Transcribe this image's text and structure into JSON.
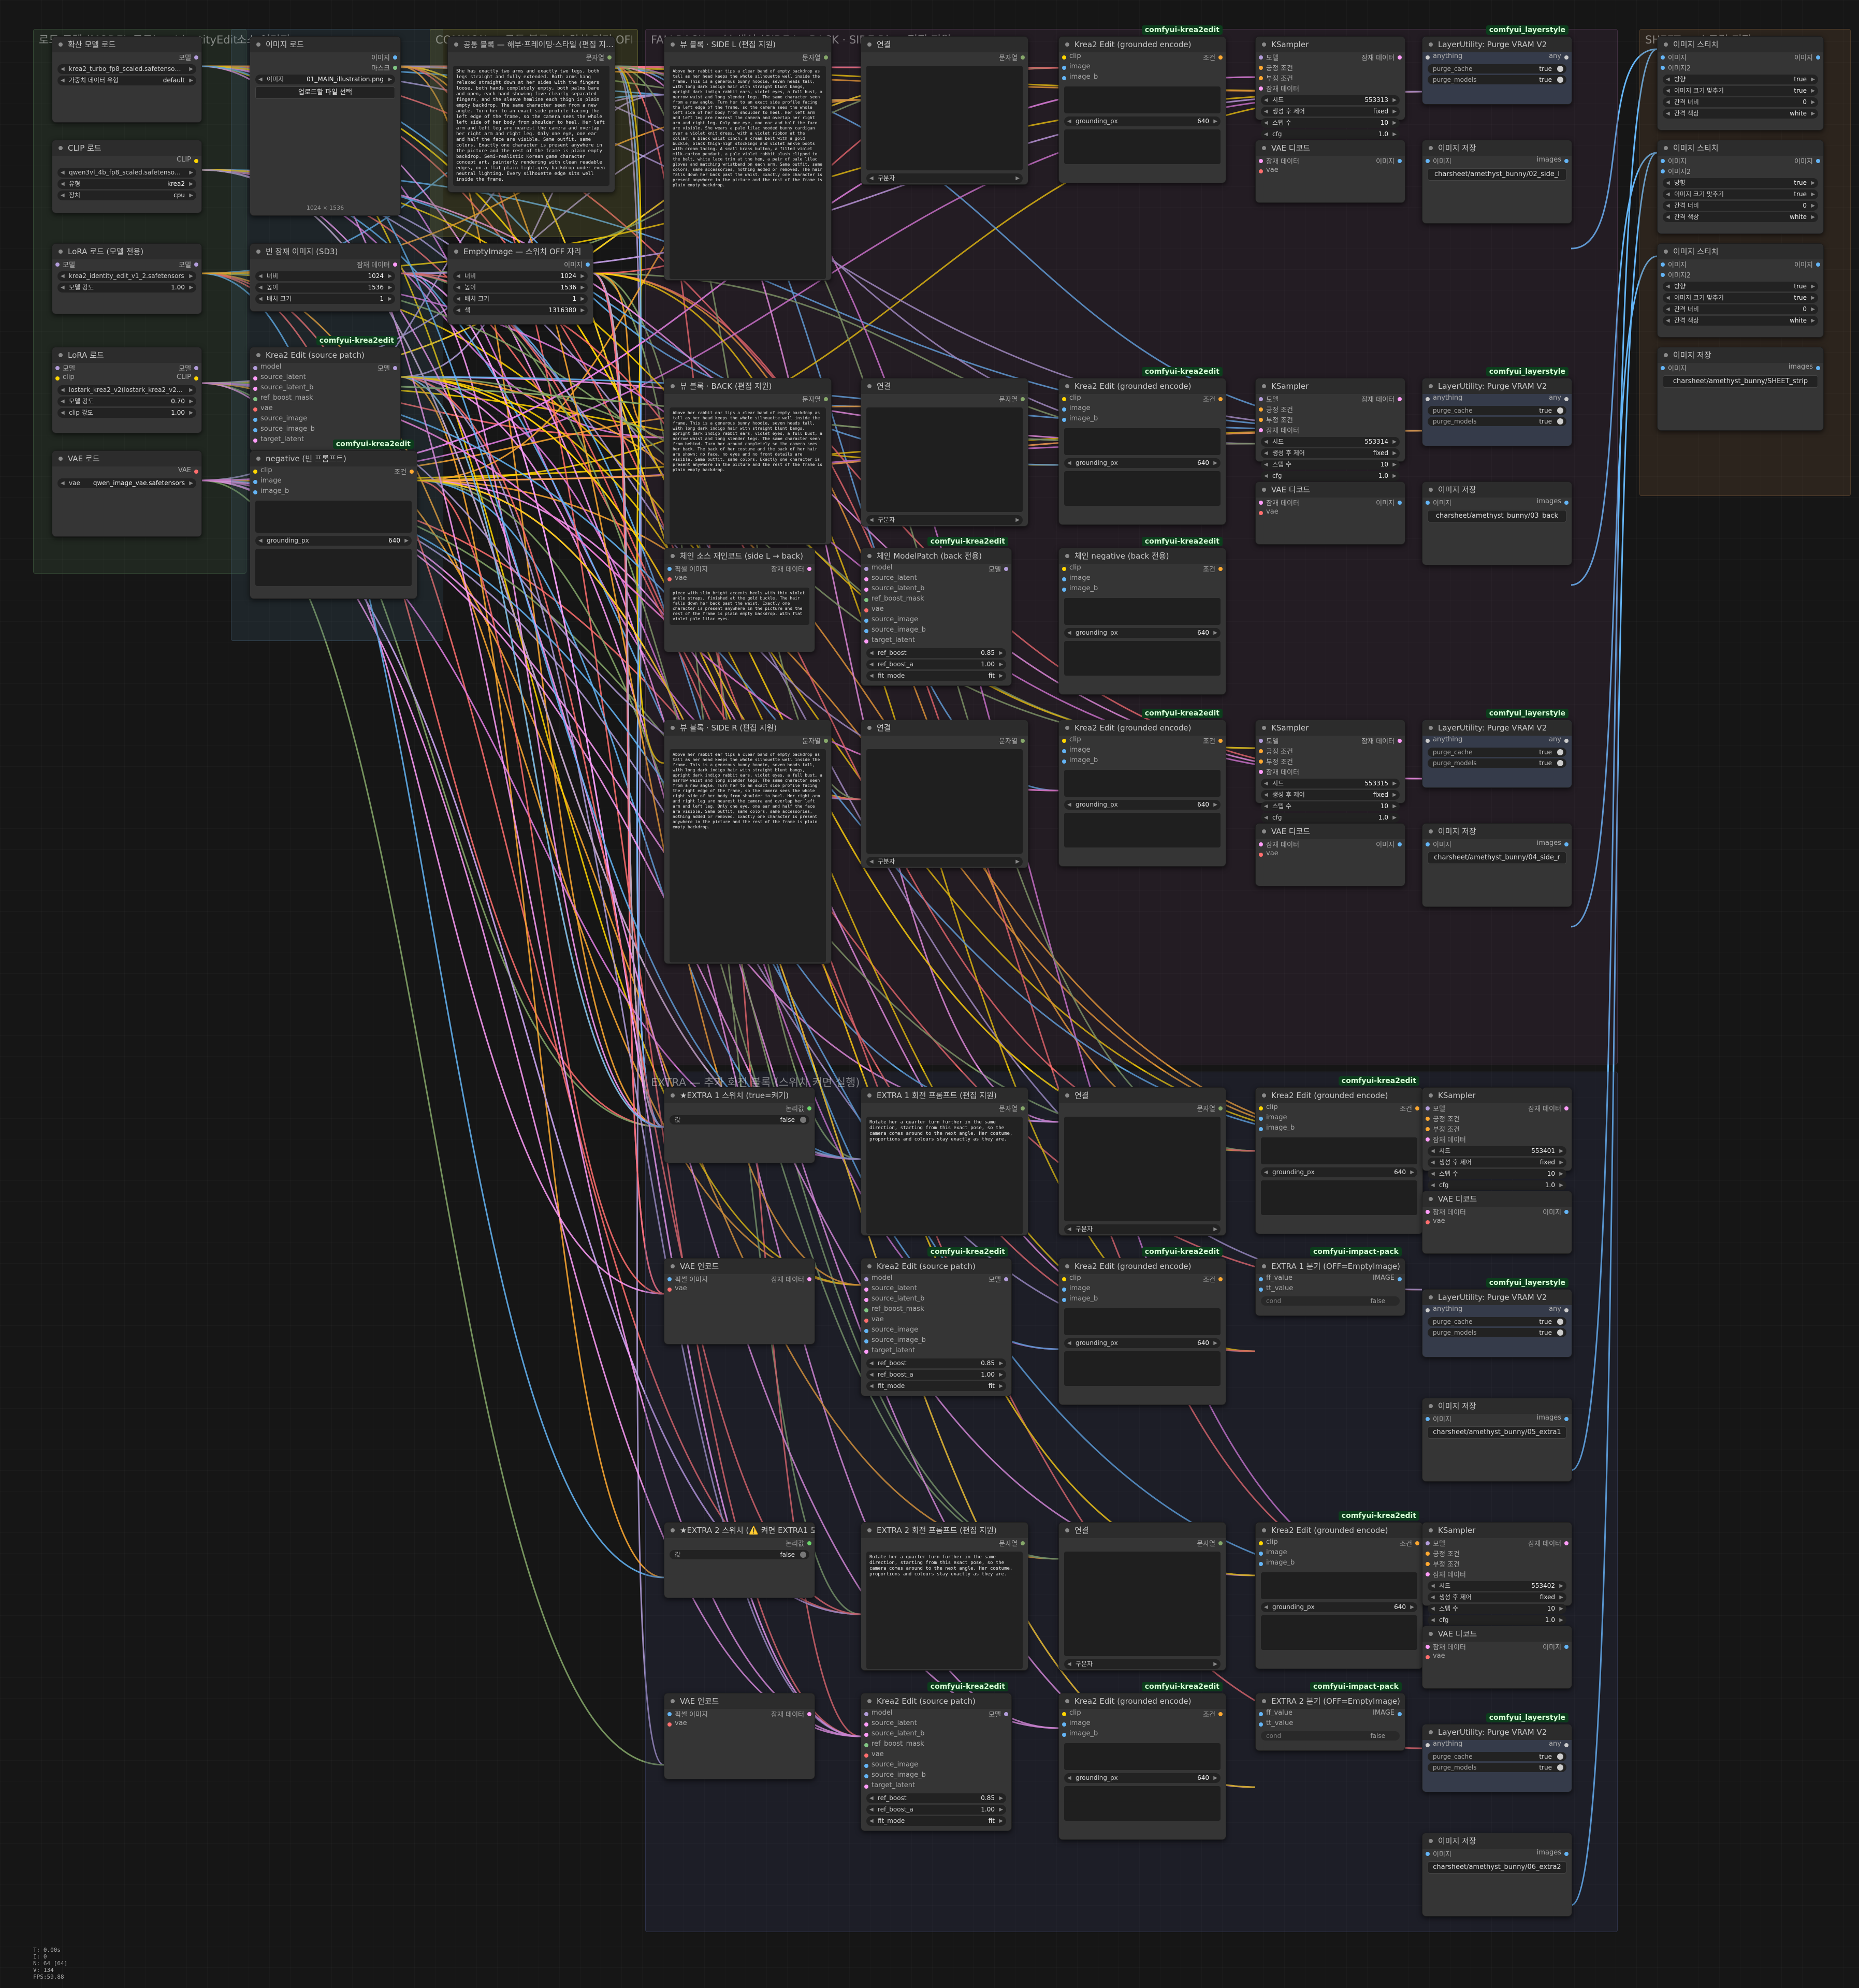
{
  "groups": {
    "load": "로드 모델 (MODEL 로드) — IdentityEdit + 캐릭터 공통 입력",
    "source": "소스 이미지",
    "common": "COMMON — 공통 블록 · 스위치 켜기 OFF",
    "main": "FALLBACK — 뷰 생성 (SIDE L · BACK · SIDE R) — 편집 지원",
    "extra": "EXTRA — 추가 회전 블록 (스위치 켜면 실행)",
    "sheet": "SHEET — 스트립 저장"
  },
  "nodes": {
    "diff": {
      "title": "확산 모델 로드",
      "out": "모델",
      "w1": "krea2_turbo_fp8_scaled.safetenso…",
      "w2l": "가중치 데이터 유형",
      "w2v": "default"
    },
    "clip": {
      "title": "CLIP 로드",
      "out": "CLIP",
      "w1": "qwen3vl_4b_fp8_scaled.safetenso…",
      "w2l": "유형",
      "w2v": "krea2",
      "w3l": "장치",
      "w3v": "cpu"
    },
    "lora1": {
      "title": "LoRA 로드 (모델 전용)",
      "in": "모델",
      "out": "모델",
      "w1": "krea2_identity_edit_v1_2.safetensors",
      "w2l": "모델 강도",
      "w2v": "1.00"
    },
    "lora2": {
      "title": "LoRA 로드",
      "in1": "모델",
      "in2": "clip",
      "out1": "모델",
      "out2": "CLIP",
      "w1": "lostark_krea2_v2(lostark_krea2_v2…",
      "w2l": "모델 강도",
      "w2v": "0.70",
      "w3l": "clip 강도",
      "w3v": "1.00"
    },
    "vae": {
      "title": "VAE 로드",
      "out": "VAE",
      "w1": "vae",
      "w1v": "qwen_image_vae.safetensors"
    },
    "img": {
      "title": "이미지 로드",
      "out1": "이미지",
      "out2": "마스크",
      "w1": "이미지",
      "w1v": "01_MAIN_illustration.png",
      "btn": "업로드할 파일 선택",
      "size": "1024 × 1536"
    },
    "empty_sd3": {
      "title": "빈 잠재 이미지 (SD3)",
      "out": "잠재 데이터",
      "wl": [
        "너비",
        "높이",
        "배치 크기"
      ],
      "wv": [
        "1024",
        "1536",
        "1"
      ]
    },
    "emptyimg": {
      "title": "EmptyImage — 스위치 OFF 자리",
      "out": "이미지",
      "wl": [
        "너비",
        "높이",
        "배치 크기",
        "색"
      ],
      "wv": [
        "1024",
        "1536",
        "1",
        "1316380"
      ]
    },
    "common": {
      "title": "공통 블록 — 해부·프레이밍·스타일 (편집 지…",
      "out": "문자열",
      "text": "She has exactly two arms and exactly two legs, both legs straight and fully extended. Both arms hang relaxed straight down at her sides with the fingers loose, both hands completely empty, both palms bare and open, each hand showing five clearly separated fingers, and the sleeve hemline each thigh is plain empty backdrop. The same character seen from a new angle. Turn her to an exact side profile facing the left edge of the frame, so the camera sees the whole left side of her body from shoulder to heel. Her left arm and left leg are nearest the camera and overlap her right arm and right leg. Only one eye, one ear and half the face are visible. Same outfit, same colors. Exactly one character is present anywhere in the picture and the rest of the frame is plain empty backdrop. Semi-realistic Korean game character concept art, painterly rendering with clean readable edges, on a flat plain light-grey backdrop under even neutral lighting. Every silhouette edge sits well inside the frame."
    },
    "kedit_src": {
      "title": "Krea2 Edit (source patch)",
      "badge": "comfyui-krea2edit",
      "ins": [
        "model",
        "source_latent",
        "source_latent_b",
        "ref_boost_mask",
        "vae",
        "source_image",
        "source_image_b",
        "target_latent"
      ],
      "out": "모델"
    },
    "neg": {
      "title": "negative (빈 프롬프트)",
      "badge": "comfyui-krea2edit",
      "ins": [
        "clip",
        "image",
        "image_b"
      ],
      "out": "조건",
      "gl": "grounding_px",
      "gv": "640"
    },
    "view_l": {
      "title": "뷰 블록 · SIDE L (편집 지원)",
      "out": "문자열",
      "text": "Above her rabbit ear tips a clear band of empty backdrop as tall as her head keeps the whole silhouette well inside the frame. This is a generous bunny hoodie, seven heads tall, with long dark indigo hair with straight blunt bangs, upright dark indigo rabbit ears, violet eyes, a full bust, a narrow waist and long slender legs. The same character seen from a new angle. Turn her to an exact side profile facing the left edge of the frame, so the camera sees the whole left side of her body from shoulder to heel. Her left arm and left leg are nearest the camera and overlap her right arm and right leg. Only one eye, one ear and half the face are visible. She wears a pale lilac hooded bunny cardigan over a violet knit dress, with a violet ribbon at the collar, a black waist cinch, a cream belt with a gold buckle, black thigh-high stockings and violet ankle boots with cream lacing. A small brass button, a filled violet milk-carton pendant, a pale violet rabbit plush clipped to the belt, white lace trim at the hem, a pair of pale lilac gloves and matching wristband on each arm. Same outfit, same colors, same accessories, nothing added or removed. The hair falls down her back past the waist. Exactly one character is present anywhere in the picture and the rest of the frame is plain empty backdrop."
    },
    "view_b": {
      "title": "뷰 블록 · BACK (편집 지원)",
      "out": "문자열",
      "text": "Above her rabbit ear tips a clear band of empty backdrop as tall as her head keeps the whole silhouette well inside the frame. This is a generous bunny hoodie, seven heads tall, with long dark indigo hair with straight blunt bangs, upright dark indigo rabbit ears, violet eyes, a full bust, a narrow waist and long slender legs. The same character seen from behind. Turn her around completely so the camera sees her back. The back of her costume and the back of her hair are shown; no face, no eyes and no front details are visible. Same outfit, same colors. Exactly one character is present anywhere in the picture and the rest of the frame is plain empty backdrop."
    },
    "view_r": {
      "title": "뷰 블록 · SIDE R (편집 지원)",
      "out": "문자열",
      "text": "Above her rabbit ear tips a clear band of empty backdrop as tall as her head keeps the whole silhouette well inside the frame. This is a generous bunny hoodie, seven heads tall, with long dark indigo hair with straight blunt bangs, upright dark indigo rabbit ears, violet eyes, a full bust, a narrow waist and long slender legs. The same character seen from a new angle. Turn her to an exact side profile facing the right edge of the frame, so the camera sees the whole right side of her body from shoulder to heel. Her right arm and right leg are nearest the camera and overlap her left arm and left leg. Only one eye, one ear and half the face are visible. Same outfit, same colors, same accessories, nothing added or removed. Exactly one character is present anywhere in the picture and the rest of the frame is plain empty backdrop."
    },
    "concat": {
      "title": "연결",
      "out": "문자열",
      "sep": "구분자"
    },
    "chain_src": {
      "title": "체인 소스 재인코드 (side L → back)",
      "ins": [
        "픽셀 이미지",
        "vae"
      ],
      "out": "잠재 데이터",
      "text": "piece with slim bright accents heels with thin violet ankle straps, finished at the gold buckle. The hair falls down her back past the waist. Exactly one character is present anywhere in the picture and the rest of the frame is plain empty backdrop. With flat violet pale lilac eyes."
    },
    "chain_patch": {
      "title": "체인 ModelPatch (back 전용)",
      "badge": "comfyui-krea2edit"
    },
    "chain_neg": {
      "title": "체인 negative (back 전용)",
      "badge": "comfyui-krea2edit"
    },
    "kenc": {
      "title": "Krea2 Edit (grounded encode)",
      "badge": "comfyui-krea2edit",
      "ins": [
        "clip",
        "image",
        "image_b"
      ],
      "out": "조건",
      "gl": "grounding_px",
      "gv": "640"
    },
    "ksampler": {
      "title": "KSampler",
      "ins": [
        "모델",
        "긍정 조건",
        "부정 조건",
        "잠재 데이터"
      ],
      "out": "잠재 데이터",
      "seed_l": "시드",
      "ctrl_l": "생성 후 제어",
      "ctrl_v": "fixed",
      "steps_l": "스텝 수",
      "steps_v": "10",
      "cfg_l": "cfg",
      "cfg_v": "1.0"
    },
    "seeds": [
      "553313",
      "553314",
      "553315",
      "553401",
      "553402"
    ],
    "vaedec": {
      "title": "VAE 디코드",
      "ins": [
        "잠재 데이터",
        "vae"
      ],
      "out": "이미지"
    },
    "purge": {
      "title": "LayerUtility: Purge VRAM V2",
      "badge": "comfyui_layerstyle",
      "in": "anything",
      "out": "any",
      "t1": "purge_cache",
      "t2": "purge_models",
      "tv": "true"
    },
    "save": {
      "title": "이미지 저장",
      "in": "이미지",
      "out": "images",
      "paths": [
        "charsheet/amethyst_bunny/02_side_l",
        "charsheet/amethyst_bunny/03_back",
        "charsheet/amethyst_bunny/04_side_r",
        "charsheet/amethyst_bunny/05_extra1",
        "charsheet/amethyst_bunny/06_extra2"
      ]
    },
    "stitch": {
      "title": "이미지 스티치",
      "ins": [
        "이미지",
        "이미지2"
      ],
      "out": "이미지",
      "wl": [
        "방향",
        "이미지 크기 맞추기",
        "간격 너비",
        "간격 색상"
      ],
      "wv": [
        "true",
        "true",
        "0",
        "white"
      ]
    },
    "save_sheet": {
      "title": "이미지 저장",
      "path": "charsheet/amethyst_bunny/SHEET_strip"
    },
    "mparams": {
      "pl": [
        "ref_boost",
        "ref_boost_a",
        "fit_mode"
      ],
      "pv": [
        "0.85",
        "1.00",
        "fit"
      ]
    },
    "x1_switch": {
      "title": "★EXTRA 1 스위치 (true=켜기)",
      "out": "논리값",
      "v": "false",
      "lbl": "값"
    },
    "x1_prompt": {
      "title": "EXTRA 1 회전 프롬프트 (편집 지원)",
      "text": "Rotate her a quarter turn further in the same direction, starting from this exact pose, so the camera comes around to the next angle. Her costume, proportions and colours stay exactly as they are."
    },
    "x2_switch": {
      "title": "★EXTRA 2 스위치 (⚠️ 켜면 EXTRA1 도 켜야 함 — 체인…",
      "out": "논리값",
      "v": "false",
      "lbl": "값"
    },
    "x2_prompt": {
      "title": "EXTRA 2 회전 프롬프트 (편집 지원)",
      "text": "Rotate her a quarter turn further in the same direction, starting from this exact pose, so the camera comes around to the next angle. Her costume, proportions and colours stay exactly as they are."
    },
    "vaeenc": {
      "title": "VAE 인코드",
      "ins": [
        "픽셀 이미지",
        "vae"
      ],
      "out": "잠재 데이터"
    },
    "x1_branch": {
      "title": "EXTRA 1 분기 (OFF=EmptyImage)",
      "badge": "comfyui-impact-pack",
      "ins": [
        "ff_value",
        "tt_value",
        "cond"
      ],
      "out": "IMAGE",
      "cv": "false"
    },
    "x2_branch": {
      "title": "EXTRA 2 분기 (OFF=EmptyImage)",
      "badge": "comfyui-impact-pack",
      "ins": [
        "ff_value",
        "tt_value",
        "cond"
      ],
      "out": "IMAGE",
      "cv": "false"
    }
  },
  "stats": [
    "T: 0.00s",
    "I: 0",
    "N: 64 [64]",
    "V: 134",
    "FPS:59.88"
  ]
}
